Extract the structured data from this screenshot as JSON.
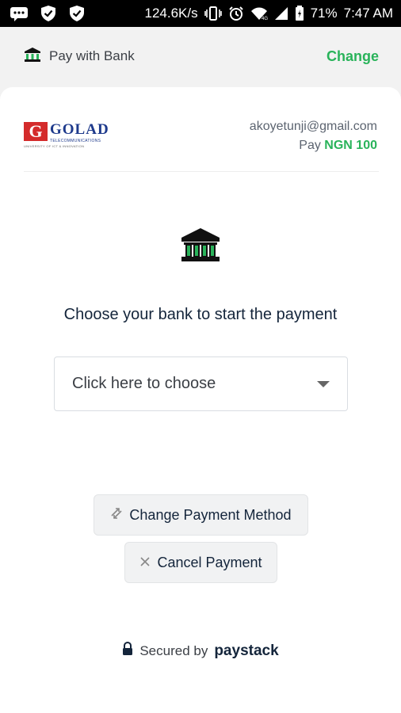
{
  "status_bar": {
    "net_speed": "124.6K/s",
    "battery": "71%",
    "time": "7:47 AM"
  },
  "header": {
    "title": "Pay with Bank",
    "change_label": "Change"
  },
  "merchant": {
    "logo_text": "GOLAD",
    "logo_letter": "G",
    "logo_subtitle": "TELECOMMUNICATIONS",
    "logo_tagline": "UNIVERSITY OF ICT & INNOVATION",
    "email": "akoyetunji@gmail.com",
    "pay_label": "Pay",
    "amount": "NGN 100"
  },
  "body": {
    "prompt": "Choose your bank to start the payment",
    "select_placeholder": "Click here to choose"
  },
  "actions": {
    "change_method_label": "Change Payment Method",
    "cancel_label": "Cancel Payment"
  },
  "footer": {
    "secured_by": "Secured by",
    "brand": "paystack"
  },
  "colors": {
    "accent": "#29b35a",
    "text": "#14253b"
  },
  "icons": {
    "header": "bank-icon",
    "hero": "bank-icon",
    "change": "swap-icon",
    "cancel": "close-icon",
    "secure": "lock-icon"
  }
}
